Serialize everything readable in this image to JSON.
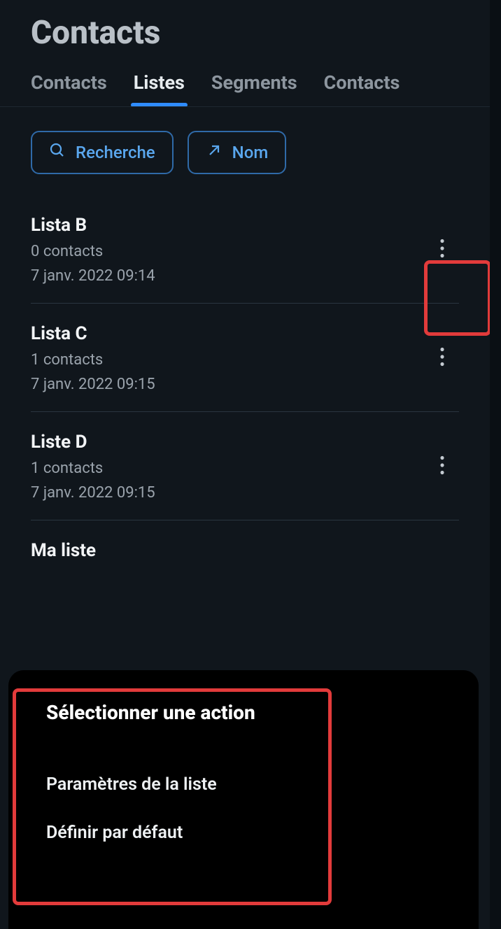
{
  "header": {
    "title": "Contacts"
  },
  "tabs": [
    {
      "label": "Contacts",
      "active": false
    },
    {
      "label": "Listes",
      "active": true
    },
    {
      "label": "Segments",
      "active": false
    },
    {
      "label": "Contacts",
      "active": false
    }
  ],
  "controls": {
    "search_label": "Recherche",
    "sort_label": "Nom"
  },
  "lists": [
    {
      "name": "Lista B",
      "count_label": "0 contacts",
      "timestamp": "7 janv. 2022 09:14"
    },
    {
      "name": "Lista C",
      "count_label": "1 contacts",
      "timestamp": "7 janv. 2022 09:15"
    },
    {
      "name": "Liste D",
      "count_label": "1 contacts",
      "timestamp": "7 janv. 2022 09:15"
    },
    {
      "name": "Ma liste",
      "count_label": "",
      "timestamp": ""
    }
  ],
  "action_sheet": {
    "title": "Sélectionner une action",
    "items": [
      "Paramètres de la liste",
      "Définir par défaut"
    ]
  },
  "colors": {
    "accent": "#2f8cff",
    "highlight": "#e23b3b"
  }
}
